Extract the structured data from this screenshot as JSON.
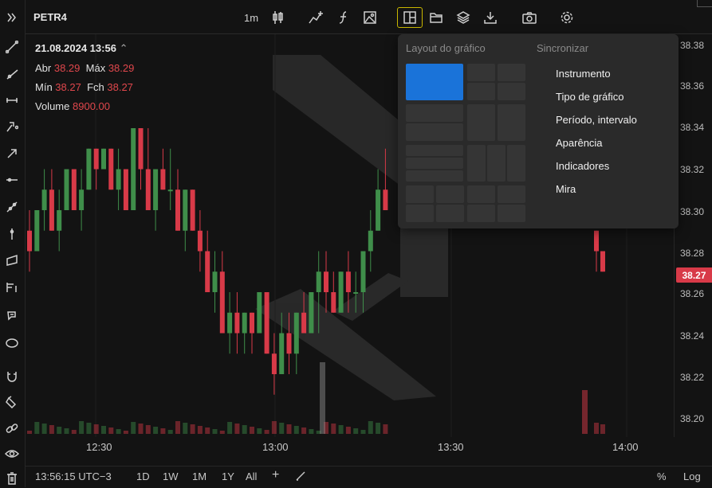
{
  "header": {
    "symbol": "PETR4",
    "interval": "1m"
  },
  "toolbar_icons": [
    "candlestick-icon",
    "indicators-icon",
    "function-icon",
    "image-icon",
    "layout-icon",
    "folder-icon",
    "layers-icon",
    "download-icon",
    "camera-icon",
    "settings-icon"
  ],
  "left_tools": [
    "chevrons-icon",
    "trendline-icon",
    "ray-icon",
    "horizontal-ray-icon",
    "pitchfork-icon",
    "arrow-icon",
    "horizontal-line-icon",
    "extended-line-icon",
    "vertical-line-icon",
    "parallel-channel-icon",
    "fib-icon",
    "brush-icon",
    "ellipse-icon",
    "magnet-icon",
    "paint-icon",
    "link-icon",
    "eye-icon",
    "trash-icon"
  ],
  "legend": {
    "datetime": "21.08.2024 13:56",
    "open_label": "Abr",
    "open": "38.29",
    "high_label": "Máx",
    "high": "38.29",
    "low_label": "Mín",
    "low": "38.27",
    "close_label": "Fch",
    "close": "38.27",
    "volume_label": "Volume",
    "volume": "8900.00"
  },
  "price_axis": [
    "38.38",
    "38.36",
    "38.34",
    "38.32",
    "38.30",
    "38.28",
    "38.26",
    "38.24",
    "38.22",
    "38.20"
  ],
  "last_price": "38.27",
  "time_axis": [
    "12:30",
    "13:00",
    "13:30",
    "14:00"
  ],
  "bottom_bar": {
    "clock": "13:56:15 UTC−3",
    "ranges": [
      "1D",
      "1W",
      "1M",
      "1Y",
      "All"
    ],
    "plus": "+",
    "percent": "%",
    "log": "Log"
  },
  "dropdown": {
    "layout_title": "Layout do gráfico",
    "sync_title": "Sincronizar",
    "sync_items": [
      "Instrumento",
      "Tipo de gráfico",
      "Período, intervalo",
      "Aparência",
      "Indicadores",
      "Mira"
    ]
  },
  "colors": {
    "up": "#3f8e4a",
    "down": "#d83a48",
    "accent": "#1a73d9",
    "background": "#131313"
  },
  "chart_data": {
    "type": "candlestick",
    "y_range": [
      38.2,
      38.39
    ],
    "x_labels": [
      "12:30",
      "13:00",
      "13:30",
      "14:00"
    ],
    "candles": [
      [
        38.29,
        38.3,
        38.27,
        38.28
      ],
      [
        38.28,
        38.3,
        38.28,
        38.3
      ],
      [
        38.3,
        38.32,
        38.29,
        38.31
      ],
      [
        38.31,
        38.32,
        38.29,
        38.29
      ],
      [
        38.29,
        38.31,
        38.28,
        38.3
      ],
      [
        38.3,
        38.32,
        38.3,
        38.32
      ],
      [
        38.32,
        38.32,
        38.3,
        38.3
      ],
      [
        38.3,
        38.32,
        38.29,
        38.31
      ],
      [
        38.31,
        38.33,
        38.31,
        38.33
      ],
      [
        38.33,
        38.33,
        38.31,
        38.32
      ],
      [
        38.32,
        38.33,
        38.32,
        38.33
      ],
      [
        38.33,
        38.33,
        38.31,
        38.31
      ],
      [
        38.31,
        38.33,
        38.3,
        38.32
      ],
      [
        38.32,
        38.32,
        38.3,
        38.3
      ],
      [
        38.3,
        38.34,
        38.3,
        38.34
      ],
      [
        38.34,
        38.34,
        38.31,
        38.32
      ],
      [
        38.32,
        38.34,
        38.3,
        38.3
      ],
      [
        38.3,
        38.32,
        38.29,
        38.32
      ],
      [
        38.32,
        38.33,
        38.31,
        38.31
      ],
      [
        38.31,
        38.33,
        38.3,
        38.31
      ],
      [
        38.31,
        38.32,
        38.29,
        38.29
      ],
      [
        38.29,
        38.31,
        38.28,
        38.31
      ],
      [
        38.31,
        38.31,
        38.29,
        38.29
      ],
      [
        38.29,
        38.3,
        38.27,
        38.28
      ],
      [
        38.28,
        38.29,
        38.26,
        38.26
      ],
      [
        38.26,
        38.28,
        38.25,
        38.27
      ],
      [
        38.27,
        38.28,
        38.24,
        38.24
      ],
      [
        38.24,
        38.26,
        38.23,
        38.25
      ],
      [
        38.25,
        38.26,
        38.23,
        38.24
      ],
      [
        38.24,
        38.25,
        38.23,
        38.25
      ],
      [
        38.25,
        38.25,
        38.23,
        38.24
      ],
      [
        38.24,
        38.26,
        38.24,
        38.26
      ],
      [
        38.26,
        38.26,
        38.23,
        38.23
      ],
      [
        38.23,
        38.24,
        38.21,
        38.22
      ],
      [
        38.22,
        38.25,
        38.22,
        38.24
      ],
      [
        38.24,
        38.25,
        38.22,
        38.23
      ],
      [
        38.23,
        38.25,
        38.22,
        38.25
      ],
      [
        38.25,
        38.26,
        38.24,
        38.24
      ],
      [
        38.24,
        38.26,
        38.24,
        38.26
      ],
      [
        38.26,
        38.28,
        38.24,
        38.27
      ],
      [
        38.27,
        38.28,
        38.25,
        38.26
      ],
      [
        38.26,
        38.27,
        38.25,
        38.25
      ],
      [
        38.25,
        38.27,
        38.25,
        38.27
      ],
      [
        38.27,
        38.28,
        38.25,
        38.26
      ],
      [
        38.26,
        38.27,
        38.25,
        38.26
      ],
      [
        38.26,
        38.28,
        38.25,
        38.28
      ],
      [
        38.28,
        38.3,
        38.27,
        38.29
      ],
      [
        38.29,
        38.32,
        38.29,
        38.31
      ],
      [
        38.31,
        38.33,
        38.3,
        38.3
      ]
    ],
    "tail_candles": [
      [
        38.29,
        38.29,
        38.27,
        38.28
      ],
      [
        38.28,
        38.28,
        38.27,
        38.27
      ]
    ]
  }
}
